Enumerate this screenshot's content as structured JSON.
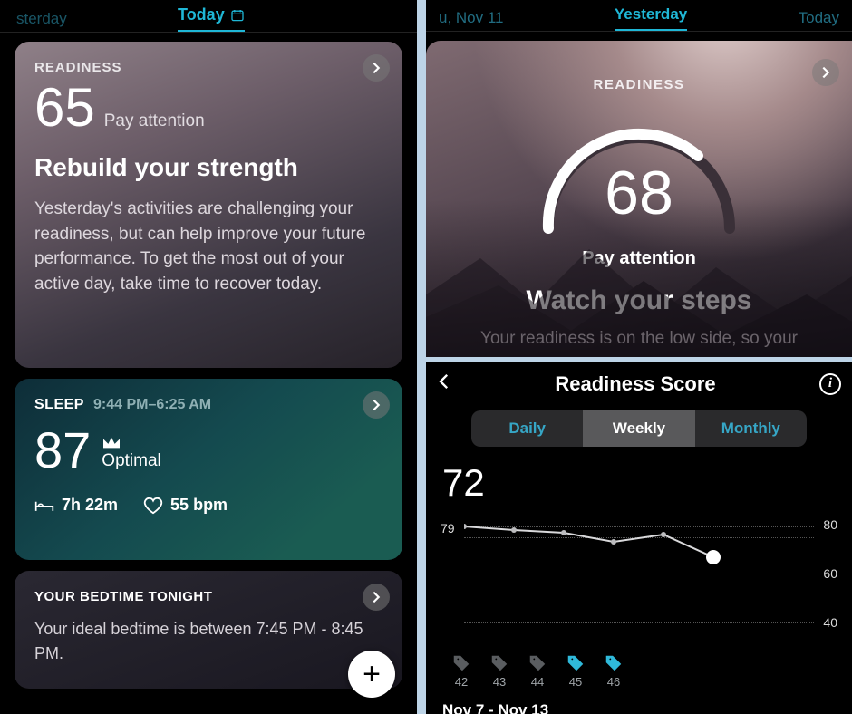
{
  "left": {
    "tab_prev": "sterday",
    "tab_current": "Today",
    "readiness": {
      "label": "READINESS",
      "score": "65",
      "tag": "Pay attention",
      "headline": "Rebuild your strength",
      "body": "Yesterday's activities are challenging your readiness, but can help improve your future performance. To get the most out of your active day, take time to recover today."
    },
    "sleep": {
      "label": "SLEEP",
      "times": "9:44 PM–6:25 AM",
      "score": "87",
      "optimal": "Optimal",
      "duration": "7h 22m",
      "bpm": "55 bpm"
    },
    "bedtime": {
      "label": "YOUR BEDTIME TONIGHT",
      "text": "Your ideal bedtime is between 7:45 PM - 8:45 PM."
    }
  },
  "rt": {
    "tab_left": "u, Nov 11",
    "tab_mid": "Yesterday",
    "tab_right": "Today",
    "label": "READINESS",
    "score": "68",
    "tag": "Pay attention",
    "headline": "Watch your steps",
    "body": "Your readiness is on the low side, so your"
  },
  "rb": {
    "title": "Readiness Score",
    "seg": {
      "daily": "Daily",
      "weekly": "Weekly",
      "monthly": "Monthly"
    },
    "score": "72",
    "ylabels": {
      "top": "80",
      "mid": "60",
      "bot": "40"
    },
    "sidelabel": "79",
    "weeks": [
      {
        "n": "42",
        "sel": false
      },
      {
        "n": "43",
        "sel": false
      },
      {
        "n": "44",
        "sel": false
      },
      {
        "n": "45",
        "sel": true
      },
      {
        "n": "46",
        "sel": true
      }
    ],
    "range": "Nov 7 - Nov 13"
  },
  "chart_data": {
    "type": "line",
    "title": "Readiness Score",
    "segment": "Weekly",
    "ylabel": "Readiness Score",
    "ylim": [
      40,
      80
    ],
    "categories": [
      "42",
      "43",
      "44",
      "45",
      "46"
    ],
    "series": [
      {
        "name": "Readiness",
        "values": [
          79,
          77,
          74,
          77,
          72
        ]
      }
    ],
    "current_value": 72,
    "left_axis_ref": 79,
    "date_range": "Nov 7 - Nov 13"
  }
}
